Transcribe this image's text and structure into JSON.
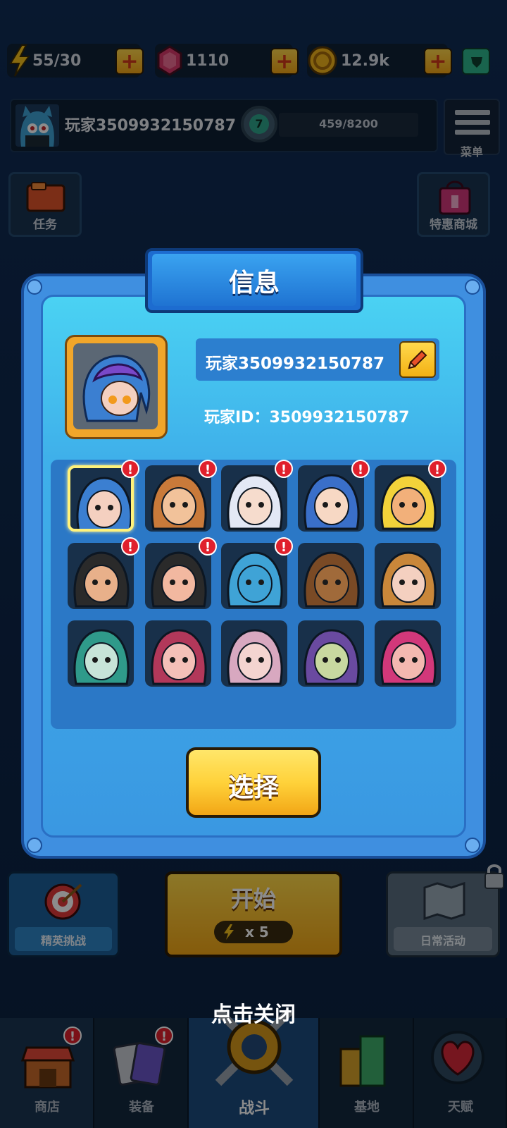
{
  "resources": {
    "energy": "55/30",
    "gems": "1110",
    "coins": "12.9k"
  },
  "profile_bar": {
    "player_name": "玩家3509932150787",
    "level": "7",
    "xp": "459/8200",
    "menu_label": "菜单"
  },
  "side": {
    "tasks_label": "任务",
    "shop_label": "特惠商城"
  },
  "modal": {
    "title": "信息",
    "player_name": "玩家3509932150787",
    "player_id_label": "玩家ID：",
    "player_id": "3509932150787",
    "select_label": "选择",
    "avatars": [
      {
        "name": "blue-hair-girl",
        "alert": true,
        "selected": true
      },
      {
        "name": "cowboy",
        "alert": true
      },
      {
        "name": "white-hair-headset",
        "alert": true
      },
      {
        "name": "blue-cap-man",
        "alert": true
      },
      {
        "name": "spiky-blond-man",
        "alert": true
      },
      {
        "name": "bearded-punk",
        "alert": true
      },
      {
        "name": "monocle-gentleman",
        "alert": true
      },
      {
        "name": "blue-monster",
        "alert": true
      },
      {
        "name": "hedgehog",
        "alert": false
      },
      {
        "name": "bun-girl",
        "alert": false
      },
      {
        "name": "teal-warrior",
        "alert": false
      },
      {
        "name": "pink-goggles-girl",
        "alert": false
      },
      {
        "name": "pink-hair-girl",
        "alert": false
      },
      {
        "name": "horned-witch",
        "alert": false
      },
      {
        "name": "pink-beanie",
        "alert": false
      }
    ]
  },
  "bottom": {
    "elite_label": "精英挑战",
    "start_label": "开始",
    "start_cost": "x 5",
    "daily_label": "日常活动",
    "close_hint": "点击关闭"
  },
  "nav": {
    "shop": "商店",
    "gear": "装备",
    "battle": "战斗",
    "base": "基地",
    "talent": "天赋"
  },
  "alert_mark": "!"
}
